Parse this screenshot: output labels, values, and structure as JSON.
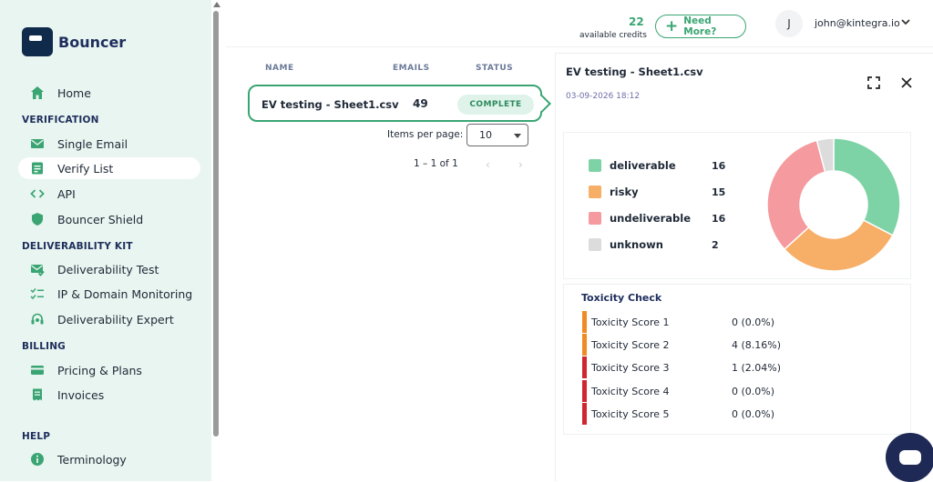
{
  "app": {
    "name": "Bouncer"
  },
  "sidebar": {
    "home": "Home",
    "sections": {
      "verification": "VERIFICATION",
      "deliverability": "DELIVERABILITY KIT",
      "billing": "BILLING",
      "help": "HELP"
    },
    "items": {
      "single_email": "Single Email",
      "verify_list": "Verify List",
      "api": "API",
      "shield": "Bouncer Shield",
      "deliv_test": "Deliverability Test",
      "ip_domain": "IP & Domain Monitoring",
      "deliv_expert": "Deliverability Expert",
      "pricing": "Pricing & Plans",
      "invoices": "Invoices",
      "terminology": "Terminology"
    }
  },
  "header": {
    "credits_count": "22",
    "credits_label": "available credits",
    "need_more": "Need More?",
    "avatar_initial": "J",
    "user_email": "john@kintegra.io"
  },
  "list": {
    "columns": {
      "name": "NAME",
      "emails": "EMAILS",
      "status": "STATUS"
    },
    "rows": [
      {
        "name": "EV testing - Sheet1.csv",
        "emails": "49",
        "status": "COMPLETE"
      }
    ],
    "items_per_page_label": "Items per page:",
    "items_per_page_value": "10",
    "range": "1 – 1 of 1"
  },
  "detail": {
    "title": "EV testing - Sheet1.csv",
    "date": "03-09-2026 18:12",
    "toxicity_title": "Toxicity Check",
    "toxicity": [
      {
        "label": "Toxicity Score 1",
        "value": "0 (0.0%)",
        "color": "#f08a24"
      },
      {
        "label": "Toxicity Score 2",
        "value": "4 (8.16%)",
        "color": "#f08a24"
      },
      {
        "label": "Toxicity Score 3",
        "value": "1 (2.04%)",
        "color": "#d0262f"
      },
      {
        "label": "Toxicity Score 4",
        "value": "0 (0.0%)",
        "color": "#d0262f"
      },
      {
        "label": "Toxicity Score 5",
        "value": "0 (0.0%)",
        "color": "#d0262f"
      }
    ]
  },
  "chart_data": {
    "type": "pie",
    "categories": [
      "deliverable",
      "risky",
      "undeliverable",
      "unknown"
    ],
    "values": [
      16,
      15,
      16,
      2
    ],
    "colors": [
      "#7ed3a6",
      "#f7ae66",
      "#f59a9e",
      "#dcdcdc"
    ],
    "title": "",
    "legend": "left"
  },
  "colors": {
    "accent": "#3aa573",
    "navy": "#1e2d5c"
  }
}
